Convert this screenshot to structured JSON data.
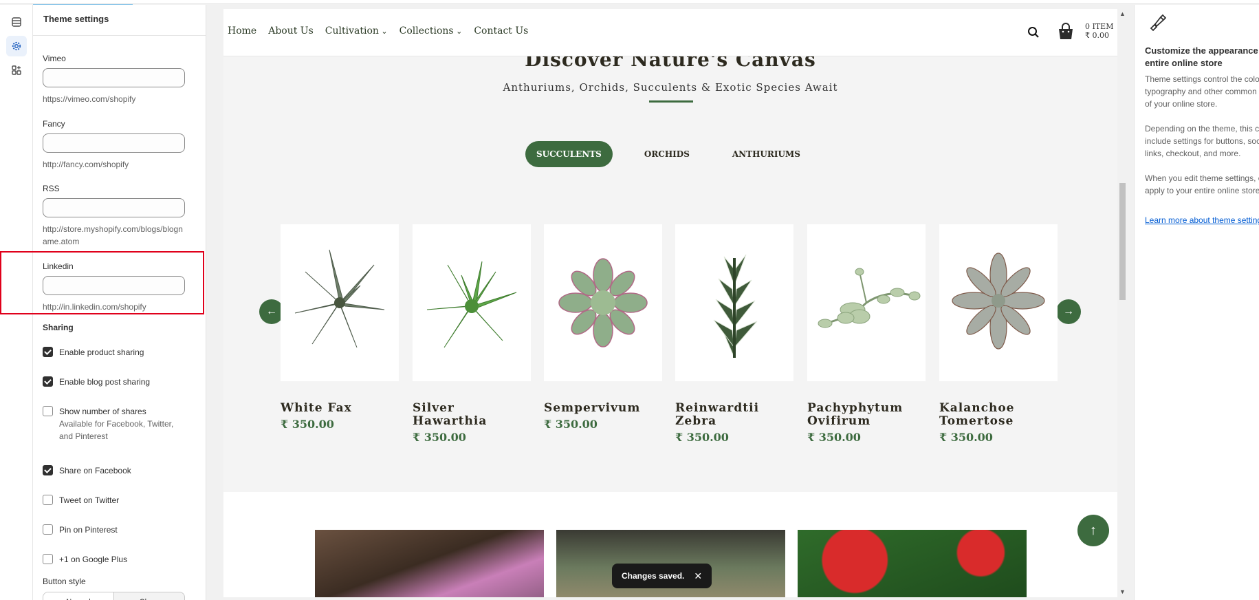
{
  "panel": {
    "title": "Theme settings",
    "fields": [
      {
        "label": "Vimeo",
        "value": "",
        "help": "https://vimeo.com/shopify"
      },
      {
        "label": "Fancy",
        "value": "",
        "help": "http://fancy.com/shopify"
      },
      {
        "label": "RSS",
        "value": "",
        "help": "http://store.myshopify.com/blogs/blogname.atom"
      },
      {
        "label": "Linkedin",
        "value": "",
        "help": "http://in.linkedin.com/shopify"
      }
    ],
    "sharing": {
      "title": "Sharing",
      "options": [
        {
          "label": "Enable product sharing",
          "checked": true
        },
        {
          "label": "Enable blog post sharing",
          "checked": true
        },
        {
          "label": "Show number of shares",
          "note": "Available for Facebook, Twitter, and Pinterest",
          "checked": false
        },
        {
          "label": "Share on Facebook",
          "checked": true
        },
        {
          "label": "Tweet on Twitter",
          "checked": false
        },
        {
          "label": "Pin on Pinterest",
          "checked": false
        },
        {
          "label": "+1 on Google Plus",
          "checked": false
        }
      ]
    },
    "button_style": {
      "label": "Button style",
      "options": [
        "Normal",
        "Clean"
      ]
    }
  },
  "preview": {
    "nav": [
      {
        "label": "Home"
      },
      {
        "label": "About Us"
      },
      {
        "label": "Cultivation"
      },
      {
        "label": "Collections"
      },
      {
        "label": "Contact Us"
      }
    ],
    "cart": {
      "count": "0 ITEM",
      "total": "₹ 0.00"
    },
    "hero": {
      "title": "Discover Nature's Canvas",
      "subtitle": "Anthuriums, Orchids, Succulents & Exotic Species Await"
    },
    "tabs": [
      "SUCCULENTS",
      "ORCHIDS",
      "ANTHURIUMS"
    ],
    "products": [
      {
        "name": "White Fax",
        "price": "₹ 350.00"
      },
      {
        "name": "Silver Hawarthia",
        "price": "₹ 350.00"
      },
      {
        "name": "Sempervivum",
        "price": "₹ 350.00"
      },
      {
        "name": "Reinwardtii Zebra",
        "price": "₹ 350.00"
      },
      {
        "name": "Pachyphytum Ovifirum",
        "price": "₹ 350.00"
      },
      {
        "name": "Kalanchoe Tomertose",
        "price": "₹ 350.00"
      }
    ],
    "toast": "Changes saved."
  },
  "info": {
    "title": "Customize the appearance of your entire online store",
    "p1": "Theme settings control the colors, typography and other common elements of your online store.",
    "p2": "Depending on the theme, this can include settings for buttons, social media links, checkout, and more.",
    "p3": "When you edit theme settings, changes apply to your entire online store.",
    "link": "Learn more about theme settings"
  },
  "colors": {
    "brand_green": "#3d6b3f",
    "highlight_red": "#e0001b"
  }
}
